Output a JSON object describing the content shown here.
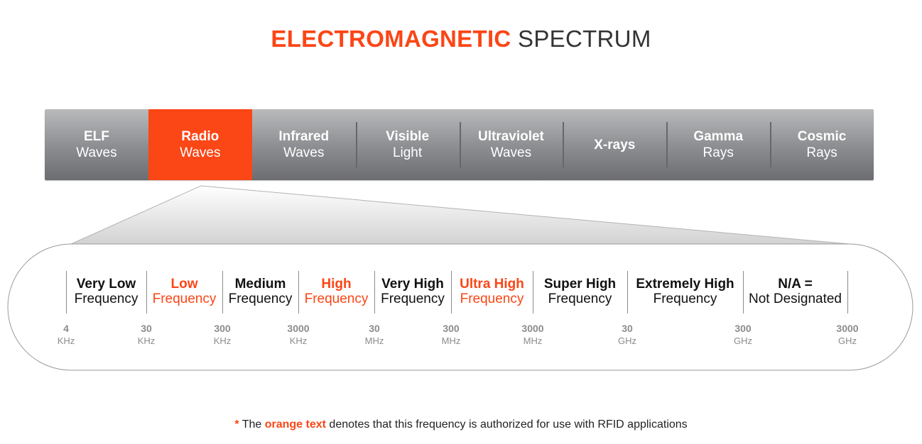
{
  "title": {
    "accent": "ELECTROMAGNETIC",
    "rest": "SPECTRUM"
  },
  "colors": {
    "accent": "#fb4616",
    "bar_dark": "#6c6d71",
    "bar_light": "#b9babc"
  },
  "spectrum": [
    {
      "line1": "ELF",
      "line2": "Waves",
      "selected": false
    },
    {
      "line1": "Radio",
      "line2": "Waves",
      "selected": true
    },
    {
      "line1": "Infrared",
      "line2": "Waves",
      "selected": false
    },
    {
      "line1": "Visible",
      "line2": "Light",
      "selected": false
    },
    {
      "line1": "Ultraviolet",
      "line2": "Waves",
      "selected": false
    },
    {
      "line1": "X-rays",
      "line2": "",
      "selected": false
    },
    {
      "line1": "Gamma",
      "line2": "Rays",
      "selected": false
    },
    {
      "line1": "Cosmic",
      "line2": "Rays",
      "selected": false
    }
  ],
  "radio_bands": [
    {
      "line1": "Very Low",
      "line2": "Frequency",
      "rfid": false
    },
    {
      "line1": "Low",
      "line2": "Frequency",
      "rfid": true
    },
    {
      "line1": "Medium",
      "line2": "Frequency",
      "rfid": false
    },
    {
      "line1": "High",
      "line2": "Frequency",
      "rfid": true
    },
    {
      "line1": "Very High",
      "line2": "Frequency",
      "rfid": false
    },
    {
      "line1": "Ultra High",
      "line2": "Frequency",
      "rfid": true
    },
    {
      "line1": "Super High",
      "line2": "Frequency",
      "rfid": false
    },
    {
      "line1": "Extremely High",
      "line2": "Frequency",
      "rfid": false
    },
    {
      "line1": "N/A =",
      "line2": "Not Designated",
      "rfid": false
    }
  ],
  "frequencies": [
    {
      "value": "4",
      "unit": "KHz"
    },
    {
      "value": "30",
      "unit": "KHz"
    },
    {
      "value": "300",
      "unit": "KHz"
    },
    {
      "value": "3000",
      "unit": "KHz"
    },
    {
      "value": "30",
      "unit": "MHz"
    },
    {
      "value": "300",
      "unit": "MHz"
    },
    {
      "value": "3000",
      "unit": "MHz"
    },
    {
      "value": "30",
      "unit": "GHz"
    },
    {
      "value": "300",
      "unit": "GHz"
    },
    {
      "value": "3000",
      "unit": "GHz"
    }
  ],
  "note": {
    "star": "*",
    "before": " The ",
    "highlight": "orange text",
    "after": " denotes that this frequency is authorized for use with RFID applications"
  }
}
